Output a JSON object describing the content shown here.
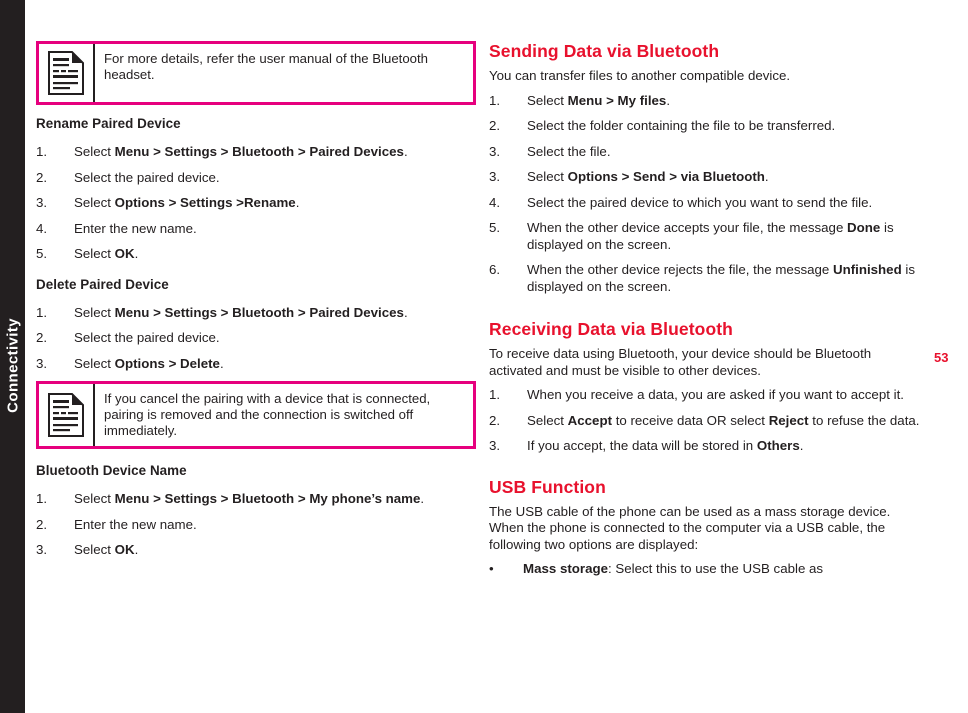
{
  "chapter": {
    "label": "Connectivity",
    "tab_color": "#231f20"
  },
  "page_number": "53",
  "colors": {
    "accent_red": "#e8112d",
    "note_border_magenta": "#e6007e",
    "text_black": "#231f20"
  },
  "left_column": {
    "note_1": {
      "icon": "document-note-icon",
      "text": "For more details, refer the user manual of the Bluetooth headset."
    },
    "section_rename": {
      "heading": "Rename Paired Device",
      "steps": [
        {
          "marker": "1.",
          "prefix": "Select ",
          "bold": "Menu > Settings > Bluetooth > Paired Devices",
          "suffix": "."
        },
        {
          "marker": "2.",
          "prefix": "Select the paired device.",
          "bold": "",
          "suffix": ""
        },
        {
          "marker": "3.",
          "prefix": "Select ",
          "bold": "Options > Settings >Rename",
          "suffix": "."
        },
        {
          "marker": "4.",
          "prefix": "Enter the new name.",
          "bold": "",
          "suffix": ""
        },
        {
          "marker": "5.",
          "prefix": "Select ",
          "bold": "OK",
          "suffix": "."
        }
      ]
    },
    "section_delete": {
      "heading": "Delete Paired Device",
      "steps": [
        {
          "marker": "1.",
          "prefix": "Select ",
          "bold": "Menu > Settings > Bluetooth > Paired Devices",
          "suffix": "."
        },
        {
          "marker": "2.",
          "prefix": "Select the paired device.",
          "bold": "",
          "suffix": ""
        },
        {
          "marker": "3.",
          "prefix": "Select ",
          "bold": "Options > Delete",
          "suffix": "."
        }
      ]
    },
    "note_2": {
      "icon": "document-note-icon",
      "text": "If you cancel the pairing with a device that is connected, pairing is removed and the connection is switched off immediately."
    },
    "section_device_name": {
      "heading": "Bluetooth Device Name",
      "steps": [
        {
          "marker": "1.",
          "prefix": "Select ",
          "bold": "Menu > Settings > Bluetooth > My phone’s name",
          "suffix": "."
        },
        {
          "marker": "2.",
          "prefix": "Enter the new name.",
          "bold": "",
          "suffix": ""
        },
        {
          "marker": "3.",
          "prefix": "Select ",
          "bold": "OK",
          "suffix": "."
        }
      ]
    }
  },
  "right_column": {
    "section_sending": {
      "heading": "Sending Data via Bluetooth",
      "intro": "You can transfer files to another compatible device.",
      "steps": [
        {
          "marker": "1.",
          "prefix": "Select ",
          "bold": "Menu > My files",
          "suffix": "."
        },
        {
          "marker": "2.",
          "prefix": "Select the folder containing the file to be transferred.",
          "bold": "",
          "suffix": ""
        },
        {
          "marker": "3.",
          "prefix": "Select the file.",
          "bold": "",
          "suffix": ""
        },
        {
          "marker": "3.",
          "prefix": "Select ",
          "bold": "Options > Send > via Bluetooth",
          "suffix": "."
        },
        {
          "marker": "4.",
          "prefix": "Select the paired device to which you want to send the file.",
          "bold": "",
          "suffix": ""
        },
        {
          "marker": "5.",
          "prefix": "When the other device accepts your file, the message ",
          "bold": "Done",
          "suffix": " is displayed on the screen."
        },
        {
          "marker": "6.",
          "prefix": "When the other device rejects the file, the message ",
          "bold": "Unfinished",
          "suffix": " is displayed on the screen."
        }
      ]
    },
    "section_receiving": {
      "heading": "Receiving Data via Bluetooth",
      "intro": "To receive data using Bluetooth, your device should be Bluetooth activated and must be visible to other devices.",
      "steps": [
        {
          "marker": "1.",
          "prefix": "When you receive a data, you are asked if you want to accept it.",
          "bold": "",
          "suffix": ""
        },
        {
          "marker": "2.",
          "prefix": "Select ",
          "bold": "Accept",
          "suffix": " to receive data OR select ",
          "bold2": "Reject",
          "suffix2": " to refuse the data."
        },
        {
          "marker": "3.",
          "prefix": "If you accept, the data will be stored in  ",
          "bold": "Others",
          "suffix": "."
        }
      ]
    },
    "section_usb": {
      "heading": "USB Function",
      "intro": "The USB cable of the phone can be used as a mass storage device. When the phone is connected to the computer via a USB cable, the following two options are displayed:",
      "steps": [
        {
          "marker": "•",
          "prefix": "",
          "bold": "Mass storage",
          "suffix": ": Select this to use the USB cable as"
        }
      ]
    }
  }
}
